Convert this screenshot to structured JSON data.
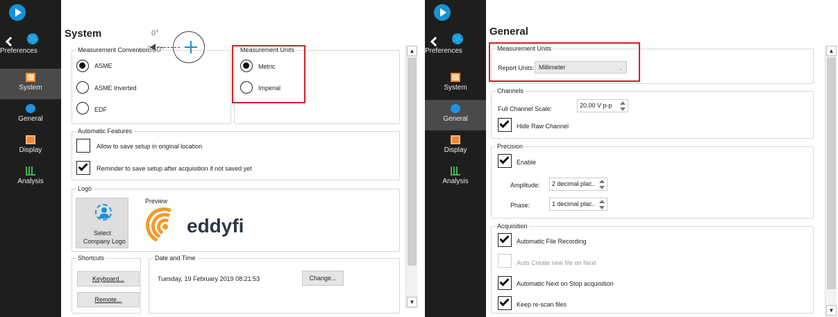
{
  "left": {
    "sidebar": {
      "preferences_label": "Preferences",
      "items": [
        {
          "label": "System",
          "icon": "system-icon"
        },
        {
          "label": "General",
          "icon": "info-icon"
        },
        {
          "label": "Display",
          "icon": "display-icon"
        },
        {
          "label": "Analysis",
          "icon": "analysis-icon"
        }
      ]
    },
    "title": "System",
    "measurement_convention": {
      "legend": "Measurement Convention",
      "options": [
        "ASME",
        "ASME Inverted",
        "EDF"
      ],
      "selected": "ASME",
      "diagram": {
        "zero": "0°",
        "threesixty": "360°"
      }
    },
    "measurement_units": {
      "legend": "Measurement Units",
      "options": [
        "Metric",
        "Imperial"
      ],
      "selected": "Metric"
    },
    "automatic_features": {
      "legend": "Automatic Features",
      "items": [
        {
          "label": "Allow to save setup in original location",
          "checked": false
        },
        {
          "label": "Reminder to save setup after acquisition if not saved yet",
          "checked": true
        }
      ]
    },
    "logo": {
      "legend": "Logo",
      "select_label_1": "Select",
      "select_label_2": "Company Logo",
      "preview_label": "Preview",
      "brand_text": "eddyfi"
    },
    "shortcuts": {
      "legend": "Shortcuts",
      "keyboard": "Keyboard...",
      "remote": "Remote..."
    },
    "date_time": {
      "legend": "Date and Time",
      "value": "Tuesday, 19 February 2019 08:21:53",
      "change": "Change..."
    }
  },
  "right": {
    "sidebar": {
      "preferences_label": "Preferences",
      "items": [
        {
          "label": "System",
          "icon": "system-icon"
        },
        {
          "label": "General",
          "icon": "info-icon"
        },
        {
          "label": "Display",
          "icon": "display-icon"
        },
        {
          "label": "Analysis",
          "icon": "analysis-icon"
        }
      ]
    },
    "title": "General",
    "measurement_units": {
      "legend": "Measurement Units",
      "report_label": "Report Units:",
      "report_value": "Millimeter"
    },
    "channels": {
      "legend": "Channels",
      "scale_label": "Full Channel Scale:",
      "scale_value": "20.00 V p-p",
      "hide_raw": "Hide Raw Channel",
      "hide_raw_checked": true
    },
    "precision": {
      "legend": "Precision",
      "enable": "Enable",
      "enable_checked": true,
      "amplitude_label": "Amplitude:",
      "amplitude_value": "2 decimal plac..",
      "phase_label": "Phase:",
      "phase_value": "1 decimal plac.."
    },
    "acquisition": {
      "legend": "Acquisition",
      "items": [
        {
          "label": "Automatic File Recording",
          "checked": true,
          "enabled": true
        },
        {
          "label": "Auto Create new file on Next",
          "checked": false,
          "enabled": false
        },
        {
          "label": "Automatic Next on Stop acquisition",
          "checked": true,
          "enabled": true
        },
        {
          "label": "Keep re-scan files",
          "checked": true,
          "enabled": true
        }
      ]
    }
  },
  "colors": {
    "sidebar": "#1e1e1e",
    "active_nav": "#4a4a4a",
    "highlight": "#d31f25",
    "accent_blue": "#1c8fd1",
    "eddyfi_orange": "#f49b2b"
  }
}
